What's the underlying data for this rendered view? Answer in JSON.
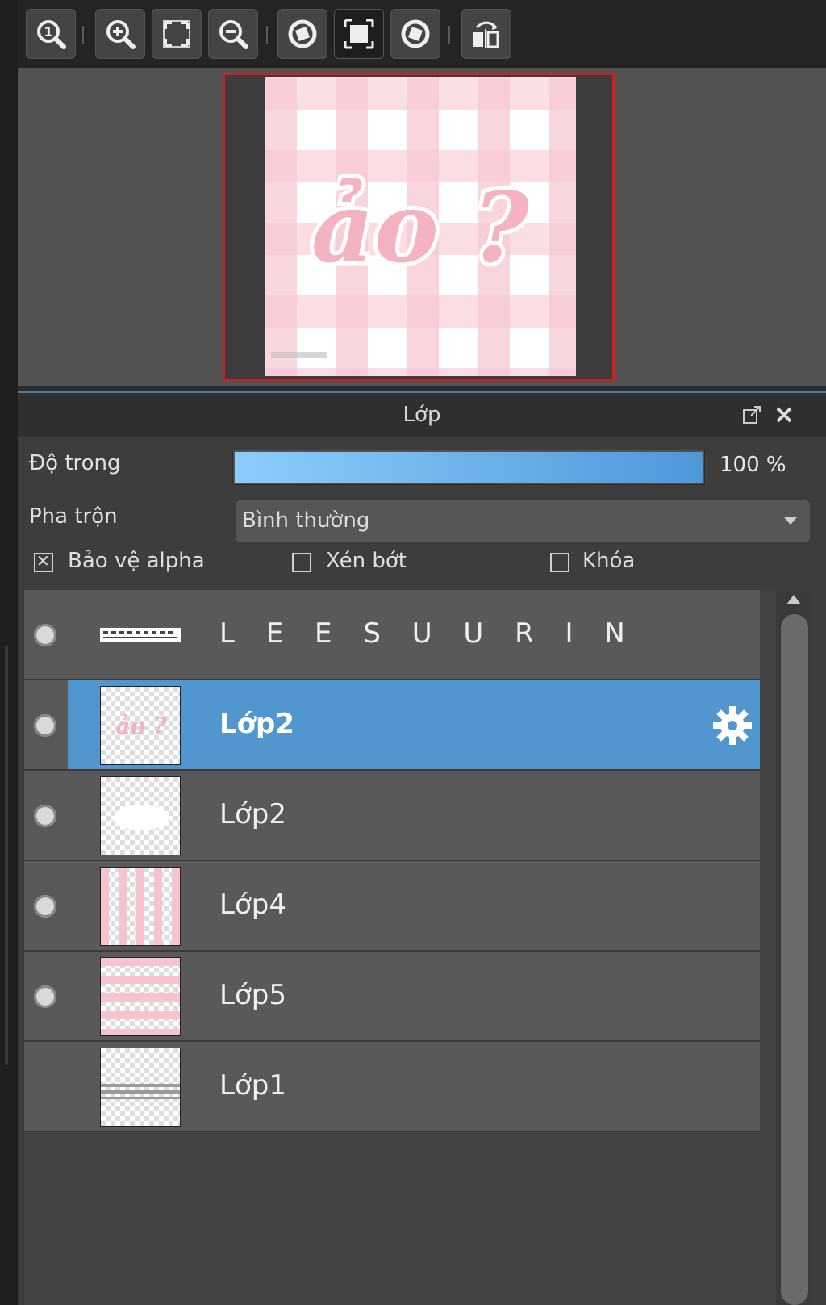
{
  "toolbar": {
    "buttons": [
      {
        "name": "zoom-actual-icon",
        "label": "1"
      },
      {
        "name": "zoom-in-icon"
      },
      {
        "name": "fit-screen-icon"
      },
      {
        "name": "zoom-out-icon"
      },
      {
        "name": "rotate-left-icon"
      },
      {
        "name": "crop-fit-icon"
      },
      {
        "name": "rotate-right-icon"
      },
      {
        "name": "flip-icon"
      }
    ]
  },
  "navigator": {
    "preview_text": "ảo ?",
    "colors": {
      "pink": "#f5c4cf",
      "light_pink": "#fbe3e8",
      "frame": "#d61c1c"
    }
  },
  "panel": {
    "title": "Lớp",
    "opacity_label": "Độ trong",
    "opacity_value_text": "100 %",
    "opacity_fraction": 1.0,
    "blend_label": "Pha trộn",
    "blend_value": "Bình thường",
    "protect_alpha_label": "Bảo vệ alpha",
    "protect_alpha_checked": true,
    "clip_label": "Xén bớt",
    "clip_checked": false,
    "lock_label": "Khóa",
    "lock_checked": false
  },
  "layers": [
    {
      "name": "L E E S U U R I N",
      "visible": true,
      "selected": false,
      "thumb": "text-strip"
    },
    {
      "name": "Lớp2",
      "visible": true,
      "selected": true,
      "thumb": "pink-text"
    },
    {
      "name": "Lớp2",
      "visible": true,
      "selected": false,
      "thumb": "white-blob"
    },
    {
      "name": "Lớp4",
      "visible": true,
      "selected": false,
      "thumb": "pink-vertical-stripes"
    },
    {
      "name": "Lớp5",
      "visible": true,
      "selected": false,
      "thumb": "pink-horizontal-stripes"
    },
    {
      "name": "Lớp1",
      "visible": false,
      "selected": false,
      "thumb": "gray-bands"
    }
  ],
  "colors": {
    "accent": "#5296d0",
    "selected_row": "#5296d0"
  }
}
